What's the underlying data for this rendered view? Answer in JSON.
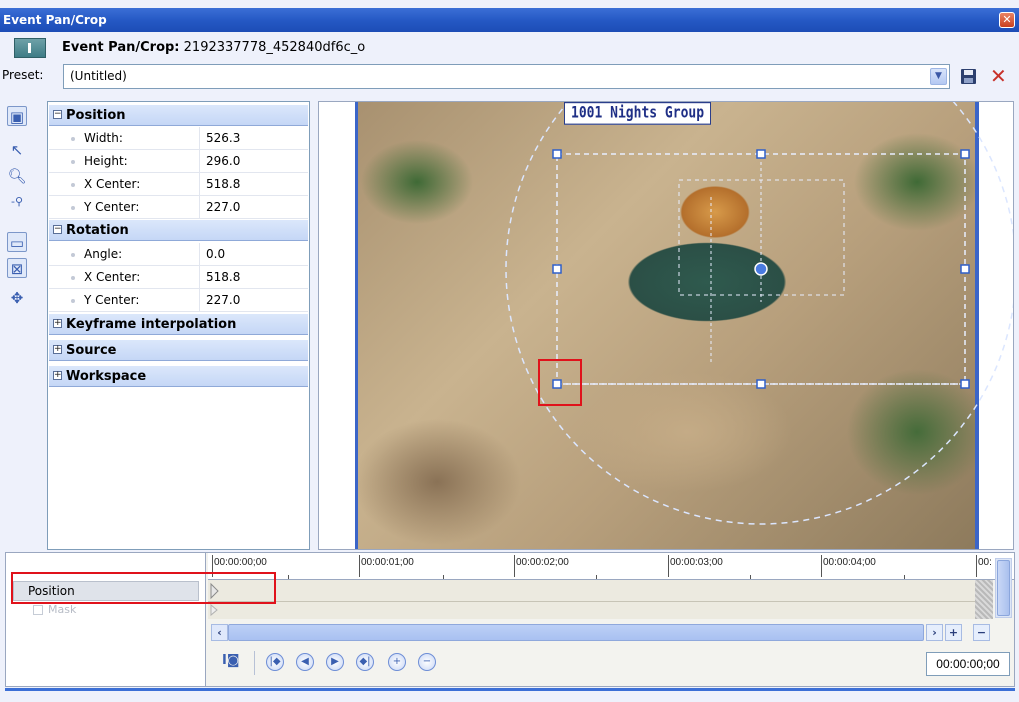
{
  "window": {
    "title": "Event Pan/Crop",
    "close_glyph": "✕"
  },
  "event": {
    "label_prefix": "Event Pan/Crop:",
    "name": "2192337778_452840df6c_o"
  },
  "preset": {
    "label": "Preset:",
    "value": "(Untitled)"
  },
  "tools": [
    "normal-edit-tool",
    "select-tool",
    "zoom-tool",
    "zoom-out-tool",
    "fit-frame",
    "fit-to-fill",
    "move-tool"
  ],
  "properties": {
    "position": {
      "header": "Position",
      "rows": [
        {
          "name": "Width:",
          "value": "526.3"
        },
        {
          "name": "Height:",
          "value": "296.0"
        },
        {
          "name": "X Center:",
          "value": "518.8"
        },
        {
          "name": "Y Center:",
          "value": "227.0"
        }
      ]
    },
    "rotation": {
      "header": "Rotation",
      "rows": [
        {
          "name": "Angle:",
          "value": "0.0"
        },
        {
          "name": "X Center:",
          "value": "518.8"
        },
        {
          "name": "Y Center:",
          "value": "227.0"
        }
      ]
    },
    "collapsed": [
      "Keyframe interpolation",
      "Source",
      "Workspace"
    ]
  },
  "preview": {
    "caption": "1001 Nights Group"
  },
  "timeline": {
    "tracks": {
      "position": "Position",
      "mask": "Mask"
    },
    "ruler": [
      "00:00:00;00",
      "00:00:01;00",
      "00:00:02;00",
      "00:00:03;00",
      "00:00:04;00",
      "00:"
    ],
    "current_time": "00:00:00;00"
  },
  "colors": {
    "titlebar": "#2457c3",
    "highlight": "#e0121b",
    "accent": "#3b65c8"
  }
}
